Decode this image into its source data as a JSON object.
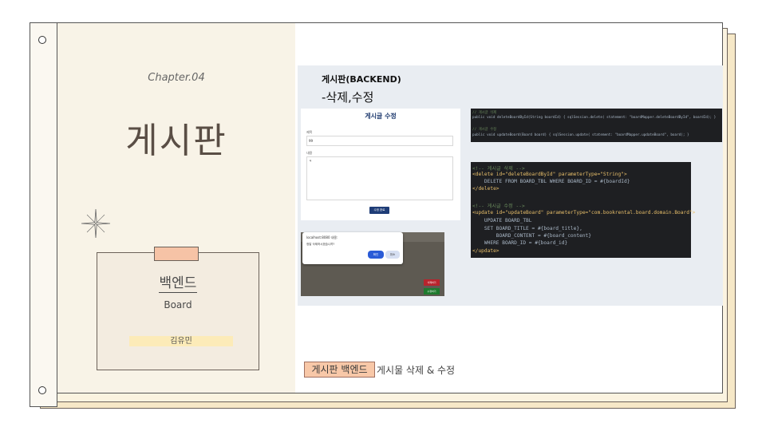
{
  "left_page": {
    "chapter": "Chapter.04",
    "title": "게시판",
    "card_title": "백엔드",
    "card_subtitle": "Board",
    "author": "김유민"
  },
  "right_page": {
    "heading": "게시판(BACKEND)",
    "subheading": "-삭제,수정",
    "form": {
      "title": "게시글 수정",
      "title_label": "제목",
      "title_value": "99",
      "content_label": "내용",
      "content_value": "ㅋ",
      "submit_label": "수정 완료"
    },
    "dialog": {
      "title": "localhost:8080 내용:",
      "message": "정말 삭제하시겠습니까?",
      "ok_label": "확인",
      "cancel_label": "취소"
    },
    "page_buttons": {
      "delete_label": "삭제하기",
      "edit_label": "수정하기"
    },
    "code_dao": [
      "// 게시글 삭제",
      "public void deleteBoardById(String boardId) { sqlSession.delete( statement: \"boardMapper.deleteBoardById\", boardId); }",
      "// 게시글 수정",
      "public void updateBoard(Board board) { sqlSession.update( statement: \"boardMapper.updateBoard\", board); }"
    ],
    "code_mapper": [
      "<!-- 게시글 삭제 -->",
      "<delete id=\"deleteBoardById\" parameterType=\"String\">",
      "    DELETE FROM BOARD_TBL WHERE BOARD_ID = #{boardId}",
      "</delete>",
      "",
      "<!-- 게시글 수정 -->",
      "<update id=\"updateBoard\" parameterType=\"com.bookrental.board.domain.Board\">",
      "    UPDATE BOARD_TBL",
      "    SET BOARD_TITLE = #{board_title},",
      "        BOARD_CONTENT = #{board_content}",
      "    WHERE BOARD_ID = #{board_id}",
      "</update>"
    ],
    "footer_tag": "게시판 백엔드",
    "footer_text": "게시물 삭제 & 수정"
  },
  "colors": {
    "accent_peach": "#f8c8a8",
    "highlight_yellow": "#fcebb8",
    "paper": "#f8f3e7",
    "code_bg": "#1e1f22",
    "form_button": "#1f3d77"
  }
}
